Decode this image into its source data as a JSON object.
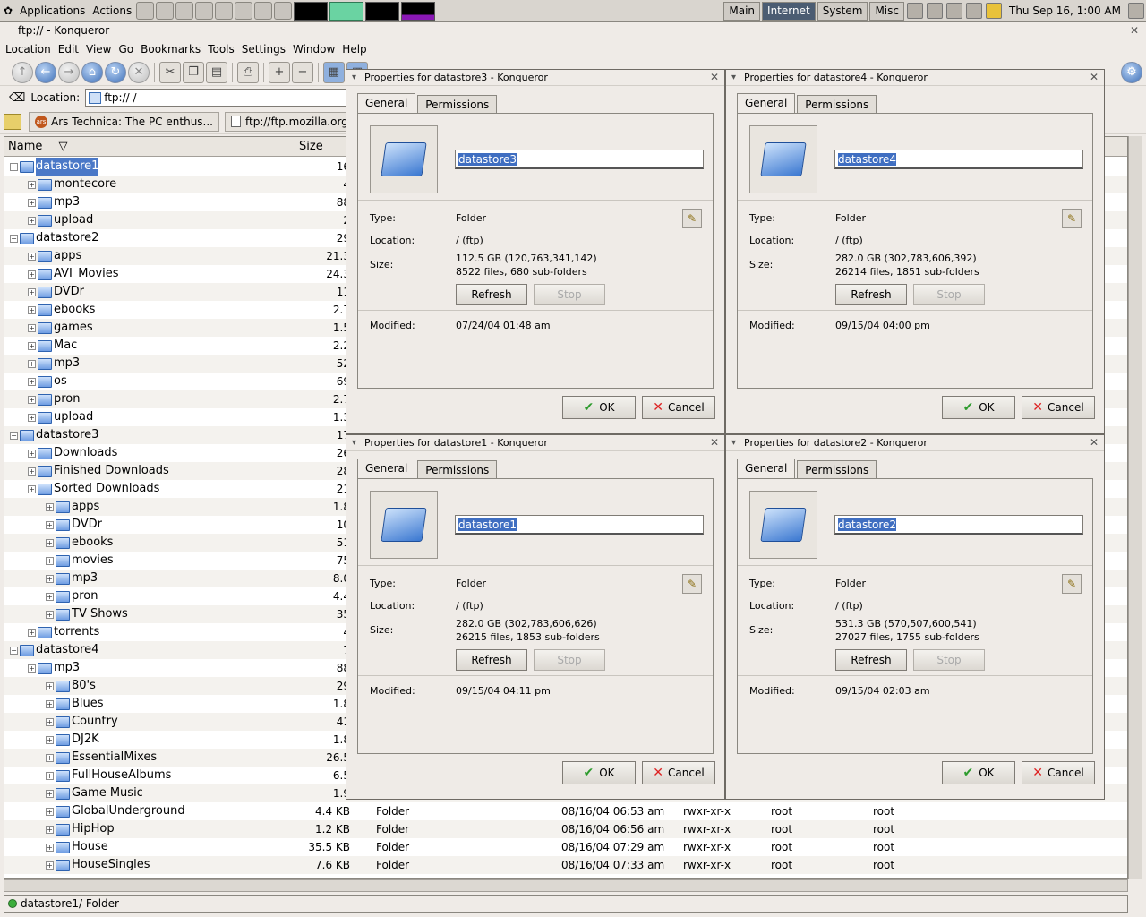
{
  "panel": {
    "menus": [
      "Applications",
      "Actions"
    ],
    "workspaces": [
      "Main",
      "Internet",
      "System",
      "Misc"
    ],
    "active_workspace": "Internet",
    "clock": "Thu Sep 16,  1:00 AM"
  },
  "window": {
    "title": "ftp://                      - Konqueror"
  },
  "menubar": [
    "Location",
    "Edit",
    "View",
    "Go",
    "Bookmarks",
    "Tools",
    "Settings",
    "Window",
    "Help"
  ],
  "location": {
    "label": "Location:",
    "value": "ftp://                                  /"
  },
  "bookmarks": [
    "Ars Technica: The PC enthus...",
    "ftp://ftp.mozilla.org/p"
  ],
  "tree": {
    "columns": [
      "Name",
      "Size"
    ],
    "rows": [
      {
        "name": "datastore1",
        "depth": 0,
        "size": "16",
        "sel": true
      },
      {
        "name": "montecore",
        "depth": 1,
        "size": "4"
      },
      {
        "name": "mp3",
        "depth": 1,
        "size": "88"
      },
      {
        "name": "upload",
        "depth": 1,
        "size": "2"
      },
      {
        "name": "datastore2",
        "depth": 0,
        "size": "29"
      },
      {
        "name": "apps",
        "depth": 1,
        "size": "21.3"
      },
      {
        "name": "AVI_Movies",
        "depth": 1,
        "size": "24.3"
      },
      {
        "name": "DVDr",
        "depth": 1,
        "size": "11"
      },
      {
        "name": "ebooks",
        "depth": 1,
        "size": "2.7"
      },
      {
        "name": "games",
        "depth": 1,
        "size": "1.5"
      },
      {
        "name": "Mac",
        "depth": 1,
        "size": "2.2"
      },
      {
        "name": "mp3",
        "depth": 1,
        "size": "52"
      },
      {
        "name": "os",
        "depth": 1,
        "size": "69"
      },
      {
        "name": "pron",
        "depth": 1,
        "size": "2.7"
      },
      {
        "name": "upload",
        "depth": 1,
        "size": "1.3"
      },
      {
        "name": "datastore3",
        "depth": 0,
        "size": "17"
      },
      {
        "name": "Downloads",
        "depth": 1,
        "size": "26"
      },
      {
        "name": "Finished Downloads",
        "depth": 1,
        "size": "28"
      },
      {
        "name": "Sorted Downloads",
        "depth": 1,
        "size": "21"
      },
      {
        "name": "apps",
        "depth": 2,
        "size": "1.8"
      },
      {
        "name": "DVDr",
        "depth": 2,
        "size": "10"
      },
      {
        "name": "ebooks",
        "depth": 2,
        "size": "51"
      },
      {
        "name": "movies",
        "depth": 2,
        "size": "75"
      },
      {
        "name": "mp3",
        "depth": 2,
        "size": "8.0"
      },
      {
        "name": "pron",
        "depth": 2,
        "size": "4.4"
      },
      {
        "name": "TV Shows",
        "depth": 2,
        "size": "35"
      },
      {
        "name": "torrents",
        "depth": 1,
        "size": "4"
      },
      {
        "name": "datastore4",
        "depth": 0,
        "size": "7"
      },
      {
        "name": "mp3",
        "depth": 1,
        "size": "88"
      },
      {
        "name": "80's",
        "depth": 2,
        "size": "29"
      },
      {
        "name": "Blues",
        "depth": 2,
        "size": "1.8"
      },
      {
        "name": "Country",
        "depth": 2,
        "size": "41"
      },
      {
        "name": "DJ2K",
        "depth": 2,
        "size": "1.8"
      },
      {
        "name": "EssentialMixes",
        "depth": 2,
        "size": "26.5"
      },
      {
        "name": "FullHouseAlbums",
        "depth": 2,
        "size": "6.5"
      },
      {
        "name": "Game Music",
        "depth": 2,
        "size": "1.9"
      },
      {
        "name": "GlobalUnderground",
        "depth": 2,
        "size": "4.4 KB",
        "type": "Folder",
        "modified": "08/16/04 06:53 am",
        "perm": "rwxr-xr-x",
        "owner": "root",
        "group": "root"
      },
      {
        "name": "HipHop",
        "depth": 2,
        "size": "1.2 KB",
        "type": "Folder",
        "modified": "08/16/04 06:56 am",
        "perm": "rwxr-xr-x",
        "owner": "root",
        "group": "root"
      },
      {
        "name": "House",
        "depth": 2,
        "size": "35.5 KB",
        "type": "Folder",
        "modified": "08/16/04 07:29 am",
        "perm": "rwxr-xr-x",
        "owner": "root",
        "group": "root"
      },
      {
        "name": "HouseSingles",
        "depth": 2,
        "size": "7.6 KB",
        "type": "Folder",
        "modified": "08/16/04 07:33 am",
        "perm": "rwxr-xr-x",
        "owner": "root",
        "group": "root"
      }
    ]
  },
  "status": "datastore1/  Folder",
  "dialog_labels": {
    "tab_general": "General",
    "tab_permissions": "Permissions",
    "type": "Type:",
    "location": "Location:",
    "size": "Size:",
    "modified": "Modified:",
    "refresh": "Refresh",
    "stop": "Stop",
    "ok": "OK",
    "cancel": "Cancel"
  },
  "dialogs": [
    {
      "title": "Properties for datastore3 - Konqueror",
      "name": "datastore3",
      "type": "Folder",
      "location": "/ (ftp)",
      "size": "112.5 GB (120,763,341,142)",
      "counts": "8522 files, 680 sub-folders",
      "modified": "07/24/04 01:48 am"
    },
    {
      "title": "Properties for datastore4 - Konqueror",
      "name": "datastore4",
      "type": "Folder",
      "location": "/ (ftp)",
      "size": "282.0 GB (302,783,606,392)",
      "counts": "26214 files, 1851 sub-folders",
      "modified": "09/15/04 04:00 pm"
    },
    {
      "title": "Properties for datastore1 - Konqueror",
      "name": "datastore1",
      "type": "Folder",
      "location": "/ (ftp)",
      "size": "282.0 GB (302,783,606,626)",
      "counts": "26215 files, 1853 sub-folders",
      "modified": "09/15/04 04:11 pm"
    },
    {
      "title": "Properties for datastore2 - Konqueror",
      "name": "datastore2",
      "type": "Folder",
      "location": "/ (ftp)",
      "size": "531.3 GB (570,507,600,541)",
      "counts": "27027 files, 1755 sub-folders",
      "modified": "09/15/04 02:03 am"
    }
  ]
}
